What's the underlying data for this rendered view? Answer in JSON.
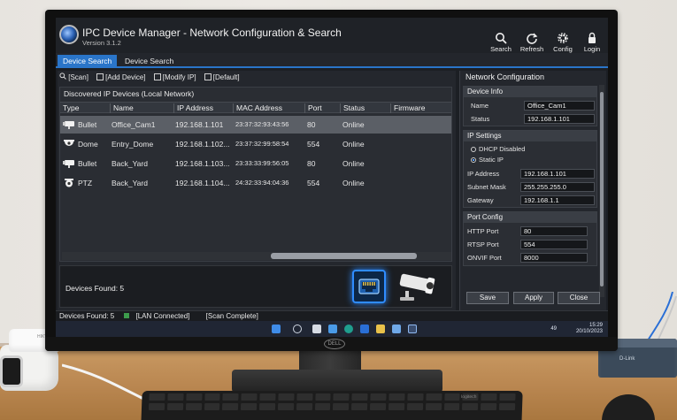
{
  "app": {
    "title": "IPC Device Manager - Network Configuration & Search",
    "version": "Version 3.1.2"
  },
  "toolbar_right": [
    {
      "label": "Search",
      "icon": "search-icon"
    },
    {
      "label": "Refresh",
      "icon": "refresh-icon"
    },
    {
      "label": "Config",
      "icon": "gear-icon"
    },
    {
      "label": "Login",
      "icon": "lock-icon"
    }
  ],
  "tabs": [
    {
      "label": "Device Search",
      "active": true
    },
    {
      "label": "Device Search",
      "active": false
    }
  ],
  "actions": {
    "scan": "[Scan]",
    "add_device": "[Add Device]",
    "modify_ip": "[Modify IP]",
    "default": "[Default]"
  },
  "device_list": {
    "title": "Discovered IP Devices (Local Network)",
    "columns": [
      "Type",
      "Name",
      "IP Address",
      "MAC Address",
      "Port",
      "Status",
      "Firmware"
    ],
    "rows": [
      {
        "type": "Bullet",
        "icon": "bullet-camera-icon",
        "name": "Office_Cam1",
        "ip": "192.168.1.101",
        "mac": "23:37:32:93:43:56",
        "port": "80",
        "status": "Online",
        "firmware": ""
      },
      {
        "type": "Dome",
        "icon": "dome-camera-icon",
        "name": "Entry_Dome",
        "ip": "192.168.1.102...",
        "mac": "23:37:32:99:58:54",
        "port": "554",
        "status": "Online",
        "firmware": ""
      },
      {
        "type": "Bullet",
        "icon": "bullet-camera-icon",
        "name": "Back_Yard",
        "ip": "192.168.1.103...",
        "mac": "23:33:33:99:56:05",
        "port": "80",
        "status": "Online",
        "firmware": ""
      },
      {
        "type": "PTZ",
        "icon": "ptz-camera-icon",
        "name": "Back_Yard",
        "ip": "192.168.1.104...",
        "mac": "24:32:33:94:04:36",
        "port": "554",
        "status": "Online",
        "firmware": ""
      }
    ]
  },
  "found_panel": {
    "text": "Devices Found: 5",
    "icons": [
      "network-port-icon",
      "cctv-camera-icon"
    ]
  },
  "network_config": {
    "title": "Network Configuration",
    "device_info": {
      "header": "Device Info",
      "name_label": "Name",
      "name_value": "Office_Cam1",
      "status_label": "Status",
      "status_value": "192.168.1.101"
    },
    "ip_settings": {
      "header": "IP Settings",
      "dhcp_label": "DHCP Disabled",
      "static_label": "Static IP",
      "ip_label": "IP Address",
      "ip_value": "192.168.1.101",
      "mask_label": "Subnet Mask",
      "mask_value": "255.255.255.0",
      "gateway_label": "Gateway",
      "gateway_value": "192.168.1.1"
    },
    "port_config": {
      "header": "Port Config",
      "http_label": "HTTP Port",
      "http_value": "80",
      "rtsp_label": "RTSP Port",
      "rtsp_value": "554",
      "onvif_label": "ONVIF Port",
      "onvif_value": "8000"
    },
    "buttons": {
      "save": "Save",
      "apply": "Apply",
      "close": "Close"
    }
  },
  "statusbar": {
    "found": "Devices Found: 5",
    "lan": "[LAN Connected]",
    "scan": "[Scan Complete]"
  },
  "taskbar": {
    "time": "15:29",
    "date": "20/10/2023",
    "volume": "49"
  },
  "scene": {
    "monitor_brand": "DELL",
    "switch_brand": "D-Link",
    "keyboard_brand": "logitech",
    "camera_brand": "HIKVISION"
  },
  "colors": {
    "accent": "#2a75c9",
    "online_indicator": "#3d9b4c",
    "highlight": "#2f8cff"
  }
}
